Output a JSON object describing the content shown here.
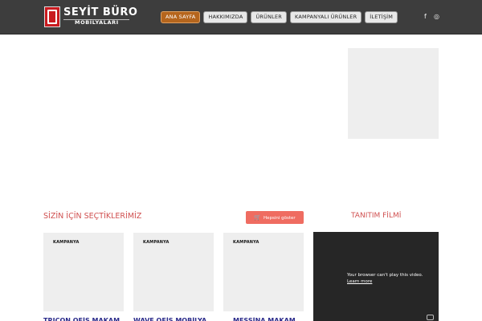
{
  "brand": {
    "name": "SEYİT BÜRO",
    "sub": "MOBİLYALARI",
    "logo_icon": "seyit-logo-icon"
  },
  "nav": {
    "items": [
      {
        "label": "ANA SAYFA",
        "active": true
      },
      {
        "label": "HAKKIMIZDA",
        "active": false
      },
      {
        "label": "ÜRÜNLER",
        "active": false
      },
      {
        "label": "KAMPANYALI ÜRÜNLER",
        "active": false
      },
      {
        "label": "İLETİŞİM",
        "active": false
      }
    ]
  },
  "social": {
    "facebook": "f",
    "instagram": "◎"
  },
  "picks": {
    "title": "SİZİN İÇİN SEÇTİKLERİMİZ",
    "show_all": "Hepsini göster",
    "cards": [
      {
        "badge": "KAMPANYA",
        "name": "TRICON OFİS MAKAM"
      },
      {
        "badge": "KAMPANYA",
        "name": "WAVE OFİS MOBİLYA"
      },
      {
        "badge": "KAMPANYA",
        "name": "MESSİNA MAKAM"
      }
    ]
  },
  "video": {
    "title": "TANITIM FİLMİ",
    "message": "Your browser can't play this video.",
    "learn_more": "Learn more"
  },
  "colors": {
    "header_bg": "#3d3d3d",
    "accent_red": "#d05050",
    "button_red": "#ef6c61",
    "active_nav": "#b5651d"
  }
}
